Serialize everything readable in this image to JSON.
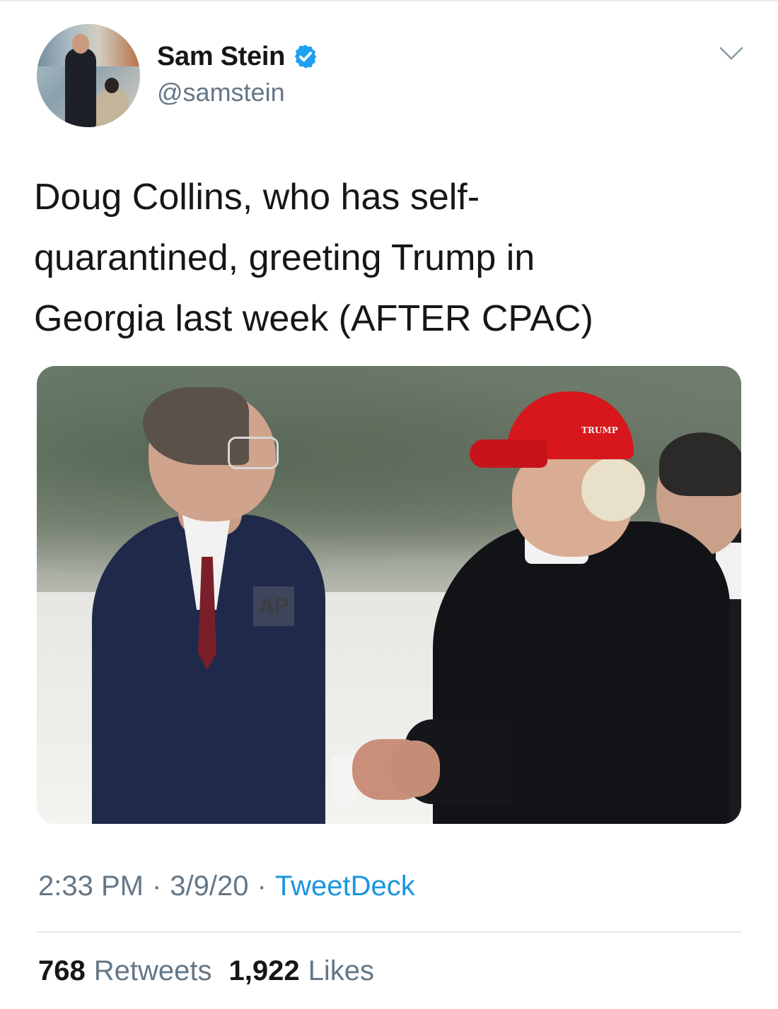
{
  "tweet": {
    "author": {
      "display_name": "Sam Stein",
      "handle": "@samstein",
      "verified": true
    },
    "text": "Doug Collins, who has self-\nquarantined, greeting Trump in\nGeorgia last week (AFTER CPAC)",
    "media": {
      "watermark": "AP",
      "cap_text": "TRUMP"
    },
    "time": "2:33 PM",
    "date": "3/9/20",
    "source": "TweetDeck",
    "separator": "·",
    "stats": {
      "retweets_count": "768",
      "retweets_label": "Retweets",
      "likes_count": "1,922",
      "likes_label": "Likes"
    }
  },
  "icons": {
    "verified": "verified-badge-icon",
    "more": "chevron-down-icon"
  },
  "colors": {
    "text_primary": "#14171a",
    "text_secondary": "#657786",
    "link": "#1b95e0",
    "verified": "#1da1f2",
    "divider": "#e1e8ed"
  }
}
